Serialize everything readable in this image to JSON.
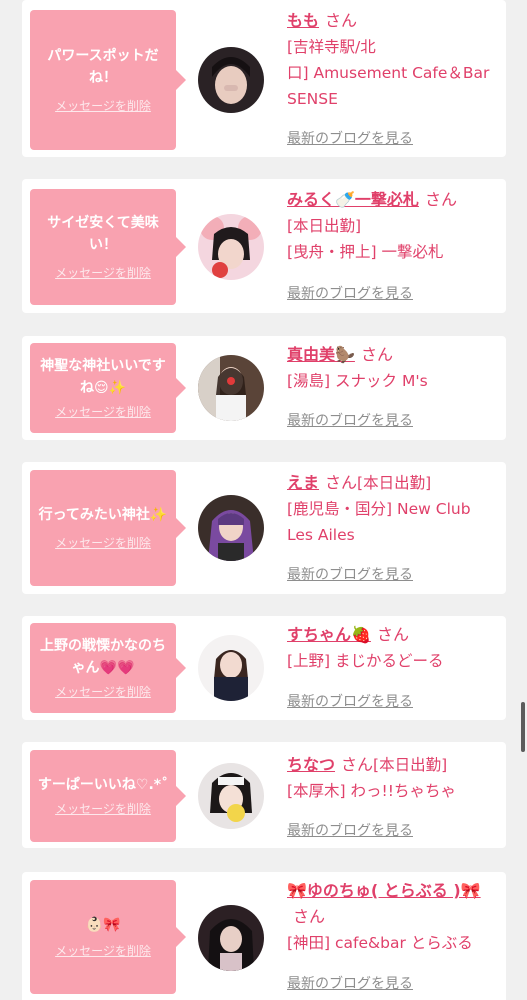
{
  "delete_label": "メッセージを削除",
  "blog_label": "最新のブログを見る",
  "san_label": "さん",
  "accent_color": "#f9a2b0",
  "text_color": "#e0406a",
  "cards": [
    {
      "message": "パワースポットだね！",
      "name": "もも",
      "shop_lines": [
        "[吉祥寺駅/北",
        "口] Amusement Cafe＆Bar",
        "SENSE"
      ]
    },
    {
      "message": "サイゼ安くて美味い！",
      "name": "みるく🍼一撃必札",
      "shop_lines": [
        "[本日出勤]",
        "[曳舟・押上] 一撃必札"
      ]
    },
    {
      "message": "神聖な神社いいですね😌✨",
      "name": "真由美🦫",
      "shop_lines": [
        "[湯島] スナック M's"
      ]
    },
    {
      "message": "行ってみたい神社✨",
      "name": "えま",
      "name_suffix": "[本日出勤]",
      "shop_lines": [
        "[鹿児島・国分] New Club",
        "Les Ailes"
      ]
    },
    {
      "message": "上野の戦慄かなのちゃん💗💗",
      "name": "すちゃん🍓",
      "shop_lines": [
        "[上野] まじかるどーる"
      ]
    },
    {
      "message": "すーぱーいいね♡.*˚",
      "name": "ちなつ",
      "name_suffix": "[本日出勤]",
      "shop_lines": [
        "[本厚木] わっ!!ちゃちゃ"
      ]
    },
    {
      "message": "👶🏻🎀",
      "name": "🎀ゆのちゅ( とらぶる )🎀",
      "shop_lines": [
        "[神田] cafe&bar とらぶる"
      ]
    }
  ]
}
